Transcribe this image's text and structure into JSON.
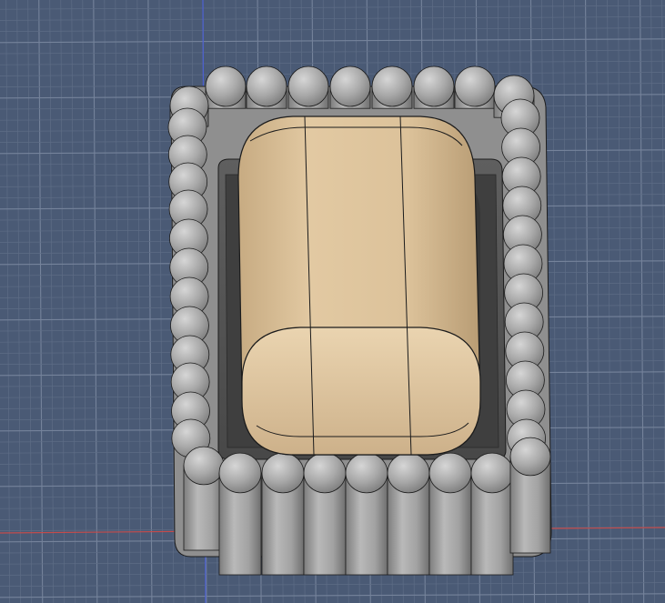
{
  "viewport": {
    "background_color": "#4a5a75",
    "grid_minor_color": "#5e6d86",
    "grid_major_color": "#75839b",
    "axis_x_color": "#c44b4b",
    "axis_y_color": "#4b5fd1"
  },
  "model": {
    "tray_name": "tray-with-rounded-pillar-rim",
    "tray_color": "#9a9a9a",
    "tray_shadow_color": "#5c5c5c",
    "rim_pillar_color": "#a6a6a6",
    "case_name": "earbud-case-body",
    "case_color": "#dcc29a",
    "case_shadow_color": "#b89c74",
    "edge_color": "#1c1c1c"
  }
}
